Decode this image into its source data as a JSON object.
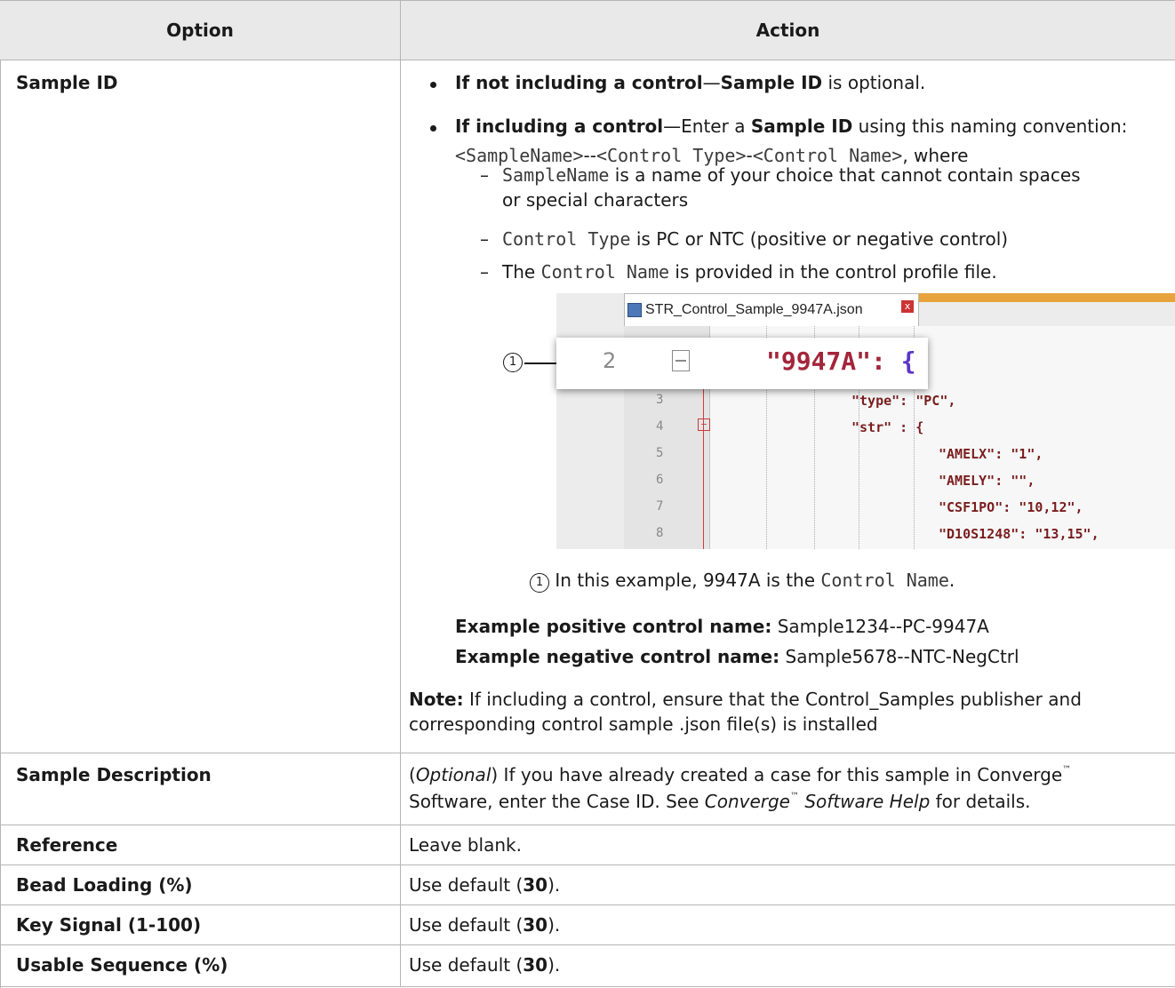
{
  "headers": {
    "option": "Option",
    "action": "Action"
  },
  "sample_id": {
    "option": "Sample ID",
    "bullet1_bold": "If not including a control",
    "bullet1_mid": "—",
    "bullet1_bold2": "Sample ID",
    "bullet1_rest": " is optional.",
    "bullet2_bold": "If including a control",
    "bullet2_mid": "—Enter a ",
    "bullet2_bold2": "Sample ID",
    "bullet2_rest": " using this naming convention:",
    "convention_a": "<SampleName>",
    "convention_b": "--",
    "convention_c": "<Control Type>",
    "convention_d": "-",
    "convention_e": "<Control Name>",
    "convention_f": ", where",
    "sub1_code": "SampleName",
    "sub1_text": " is a name of your choice that cannot contain spaces",
    "sub1_text2": "or special characters",
    "sub2_code": "Control Type",
    "sub2_text": " is PC or NTC (positive or negative control)",
    "sub3_pre": "The ",
    "sub3_code": "Control Name",
    "sub3_text": " is provided in the control profile file.",
    "screenshot": {
      "tab_title": "STR_Control_Sample_9947A.json",
      "close_glyph": "x",
      "magnified_line_number": "2",
      "magnified_code_key": "\"9947A\": ",
      "magnified_code_brace": "{",
      "lines": [
        {
          "n": "3",
          "code": "\"type\": \"PC\","
        },
        {
          "n": "4",
          "code": "\"str\" : {"
        },
        {
          "n": "5",
          "code": "\"AMELX\": \"1\","
        },
        {
          "n": "6",
          "code": "\"AMELY\": \"\","
        },
        {
          "n": "7",
          "code": "\"CSF1PO\": \"10,12\","
        },
        {
          "n": "8",
          "code": "\"D10S1248\": \"13,15\","
        }
      ],
      "callout_number": "1"
    },
    "caption_num": "1",
    "caption_pre": " In this example, 9947A is the ",
    "caption_code": "Control Name",
    "caption_post": ".",
    "ex_pos_label": "Example positive control name:",
    "ex_pos_value": " Sample1234--PC-9947A",
    "ex_neg_label": "Example negative control name:",
    "ex_neg_value": " Sample5678--NTC-NegCtrl",
    "note_label": "Note:",
    "note_line1": "  If including a control, ensure that the Control_Samples publisher and",
    "note_line2": "corresponding control sample .json file(s) is installed"
  },
  "sample_description": {
    "option": "Sample Description",
    "l1_open": "(",
    "l1_italic": "Optional",
    "l1_close": ")",
    "l1_rest": " If you have already created a case for this sample in Converge",
    "tm": "™",
    "l2_pre": "Software, enter the Case ID. See ",
    "l2_italic1": "Converge",
    "l2_italic2": " Software Help",
    "l2_post": " for details."
  },
  "rows": [
    {
      "option": "Reference",
      "action_pre": "Leave blank.",
      "action_bold": "",
      "action_post": ""
    },
    {
      "option": "Bead Loading (%)",
      "action_pre": "Use default (",
      "action_bold": "30",
      "action_post": ")."
    },
    {
      "option": "Key Signal (1-100)",
      "action_pre": "Use default (",
      "action_bold": "30",
      "action_post": ")."
    },
    {
      "option": "Usable Sequence (%)",
      "action_pre": "Use default (",
      "action_bold": "30",
      "action_post": ")."
    }
  ]
}
